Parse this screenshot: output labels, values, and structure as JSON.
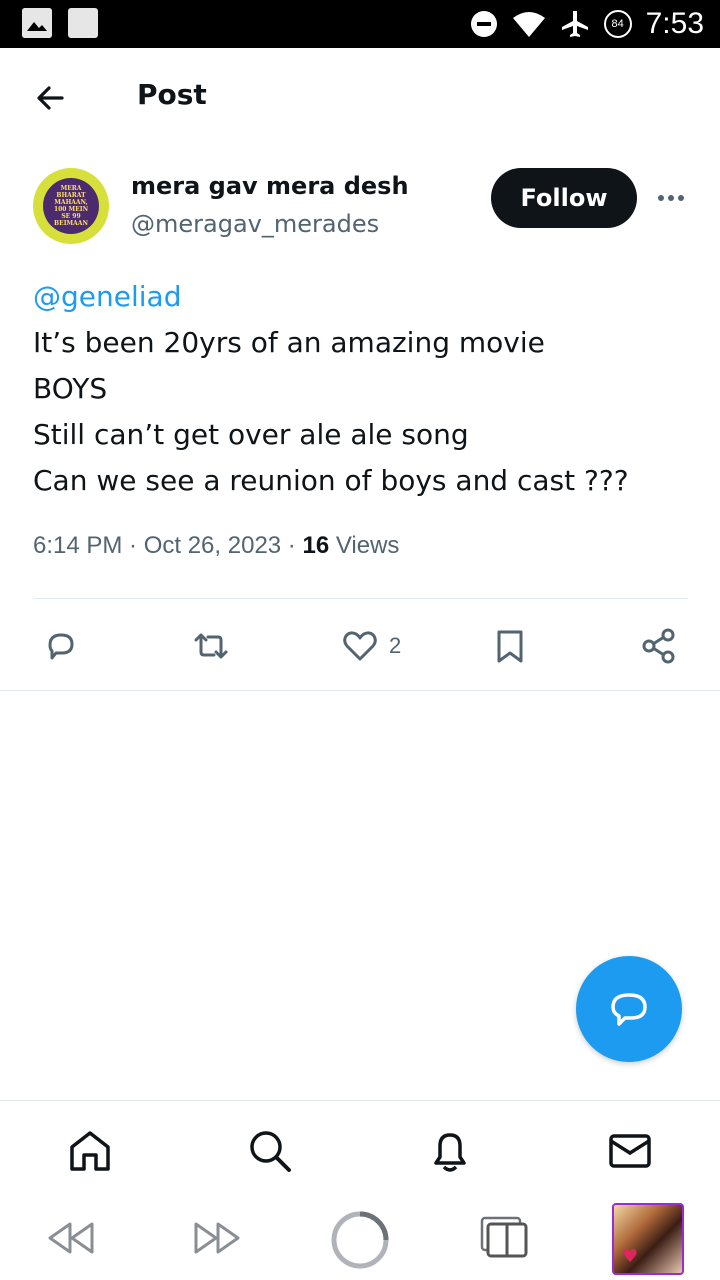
{
  "status_bar": {
    "time": "7:53",
    "battery": "84",
    "icons": [
      "image-icon",
      "square-icon",
      "do-not-disturb-icon",
      "wifi-icon",
      "airplane-icon",
      "battery-icon"
    ]
  },
  "header": {
    "title": "Post"
  },
  "author": {
    "display_name": "mera gav mera desh",
    "handle": "@meragav_merades",
    "avatar_text": [
      "MERA",
      "BHARAT",
      "MAHAAN,",
      "100 MEIN",
      "SE 99",
      "BEIMAAN"
    ],
    "follow_label": "Follow"
  },
  "tweet": {
    "mention": "@geneliad",
    "lines": [
      "It’s been 20yrs of an amazing movie",
      "BOYS",
      "Still can’t get over ale ale song",
      "Can we see a reunion of boys and cast ???"
    ],
    "timestamp": "6:14 PM · Oct 26, 2023 · ",
    "views_count": "16",
    "views_label": " Views"
  },
  "actions": {
    "like_count": "2"
  },
  "colors": {
    "accent": "#1d9bf0",
    "text_primary": "#0f1419",
    "text_secondary": "#536471",
    "follow_bg": "#0f1419"
  }
}
